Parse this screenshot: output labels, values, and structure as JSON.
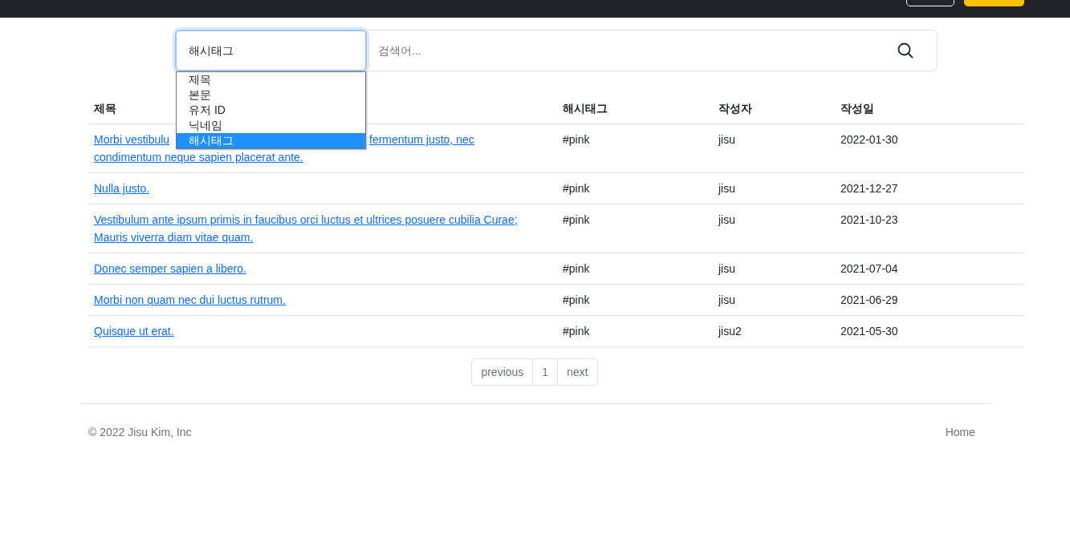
{
  "search": {
    "field_value": "해시태그",
    "options": [
      {
        "label": "제목",
        "selected": false
      },
      {
        "label": "본문",
        "selected": false
      },
      {
        "label": "유저 ID",
        "selected": false
      },
      {
        "label": "닉네임",
        "selected": false
      },
      {
        "label": "해시태그",
        "selected": true
      }
    ],
    "placeholder": "검색어..."
  },
  "table": {
    "columns": [
      "제목",
      "해시태그",
      "작성자",
      "작성일"
    ],
    "rows": [
      {
        "title_parts": [
          "Morbi vestibulu",
          "fermentum justo, nec",
          "condimentum neque sapien placerat ante."
        ],
        "hashtag": "#pink",
        "author": "jisu",
        "date": "2022-01-30"
      },
      {
        "title_parts": [
          "Nulla justo."
        ],
        "hashtag": "#pink",
        "author": "jisu",
        "date": "2021-12-27"
      },
      {
        "title_parts": [
          "Vestibulum ante ipsum primis in faucibus orci luctus et ultrices posuere cubilia Curae; Mauris viverra diam vitae quam."
        ],
        "hashtag": "#pink",
        "author": "jisu",
        "date": "2021-10-23"
      },
      {
        "title_parts": [
          "Donec semper sapien a libero."
        ],
        "hashtag": "#pink",
        "author": "jisu",
        "date": "2021-07-04"
      },
      {
        "title_parts": [
          "Morbi non quam nec dui luctus rutrum."
        ],
        "hashtag": "#pink",
        "author": "jisu",
        "date": "2021-06-29"
      },
      {
        "title_parts": [
          "Quisque ut erat."
        ],
        "hashtag": "#pink",
        "author": "jisu2",
        "date": "2021-05-30"
      }
    ]
  },
  "pagination": [
    "previous",
    "1",
    "next"
  ],
  "footer": {
    "copyright": "© 2022 Jisu Kim, Inc",
    "link": "Home"
  }
}
